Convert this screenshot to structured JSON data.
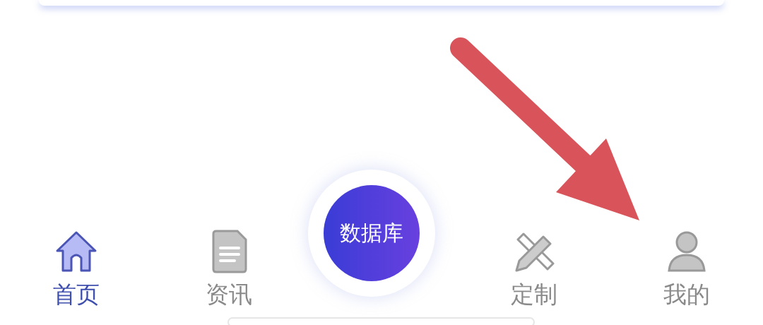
{
  "tabs": [
    {
      "label": "首页",
      "selected": true
    },
    {
      "label": "资讯",
      "selected": false
    },
    {
      "label": "定制",
      "selected": false
    },
    {
      "label": "我的",
      "selected": false
    }
  ],
  "center_button": {
    "label": "数据库"
  }
}
